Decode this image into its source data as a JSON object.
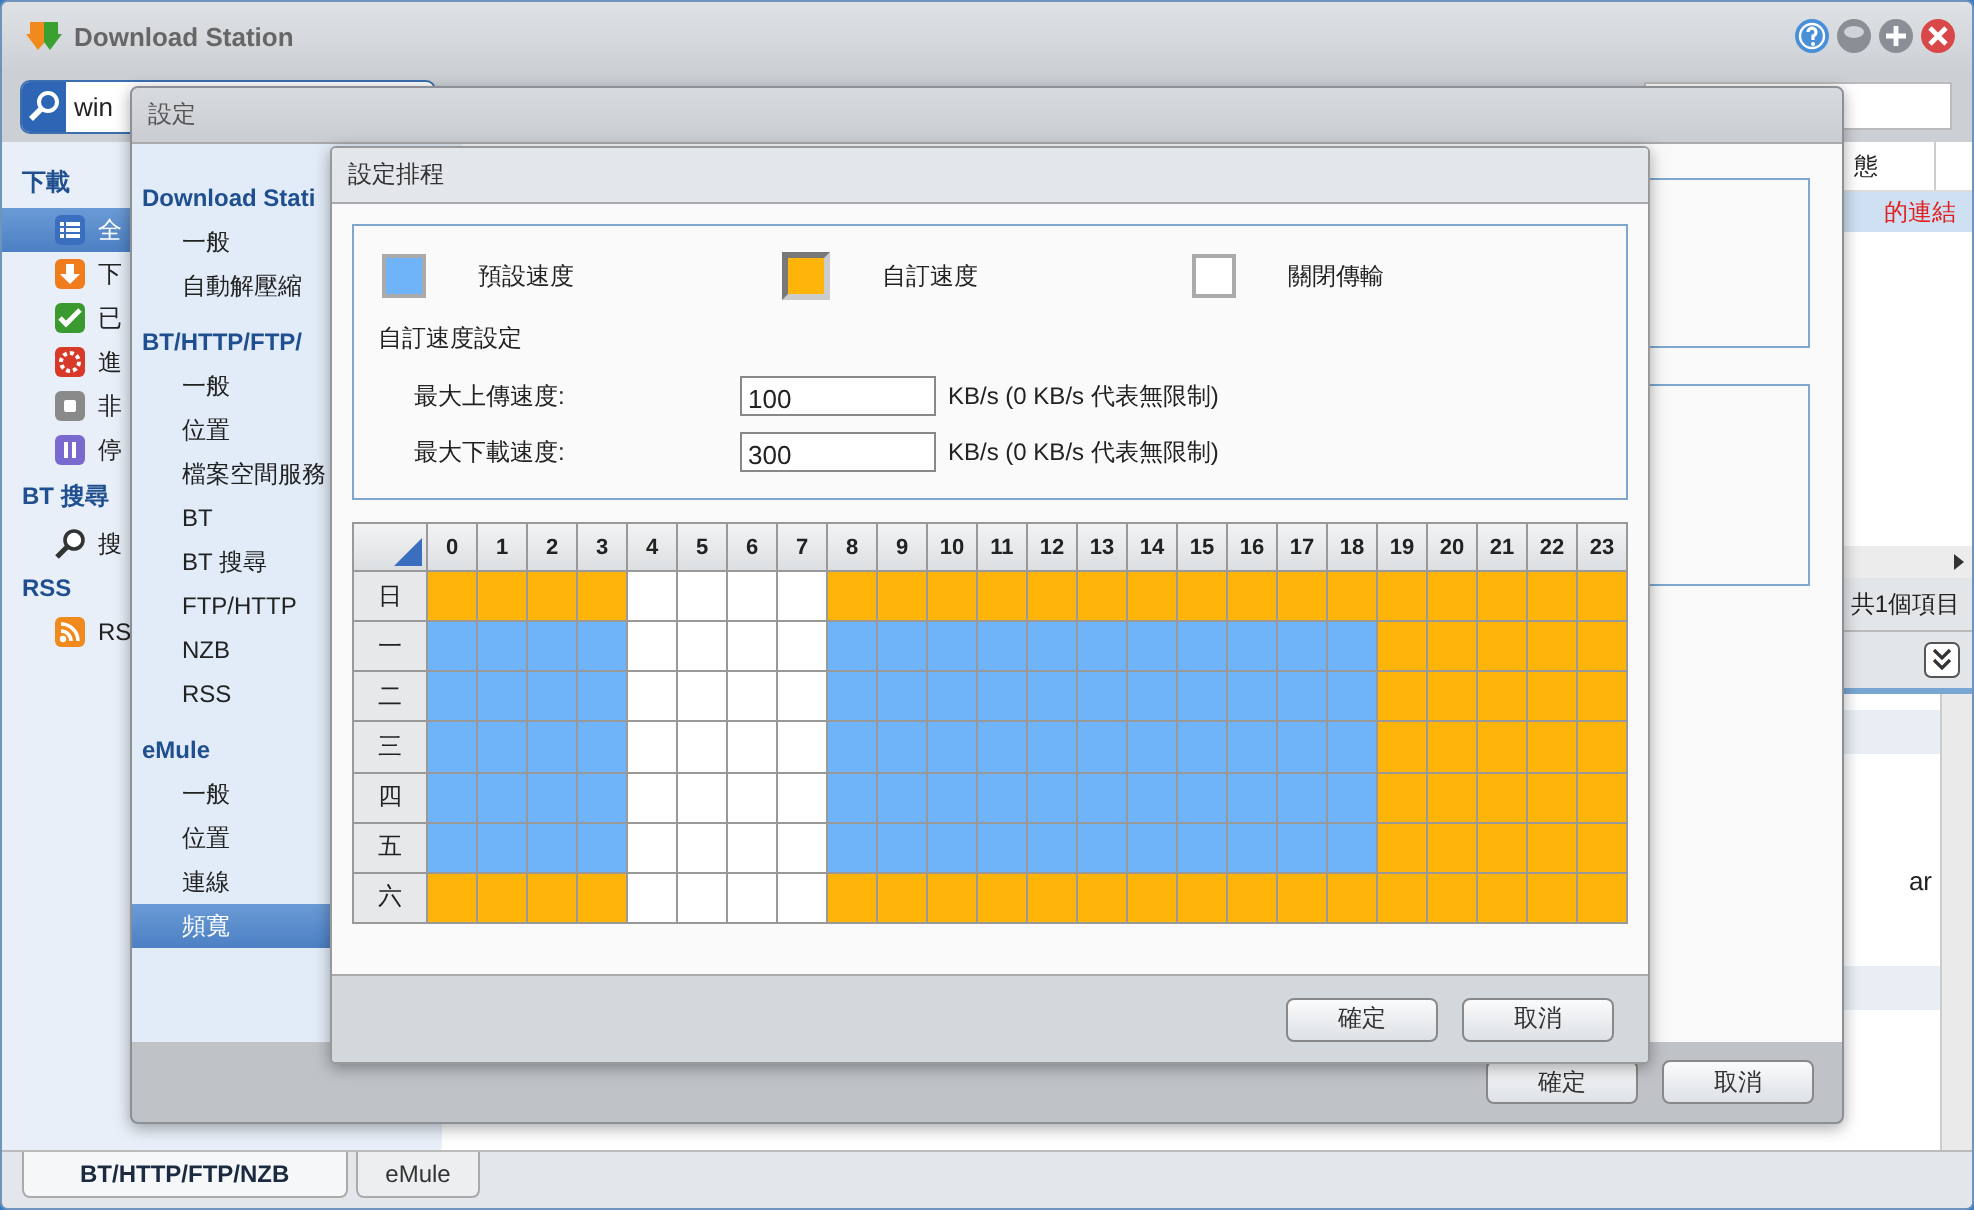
{
  "main_window": {
    "title": "Download Station",
    "search": {
      "value": "win"
    },
    "sidebar": [
      {
        "heading": "下載",
        "items": [
          {
            "label": "全",
            "kind": "list",
            "selected": true
          },
          {
            "label": "下",
            "kind": "download",
            "selected": false
          },
          {
            "label": "已",
            "kind": "done",
            "selected": false
          },
          {
            "label": "進",
            "kind": "active",
            "selected": false
          },
          {
            "label": "非",
            "kind": "inactive",
            "selected": false
          },
          {
            "label": "停",
            "kind": "paused",
            "selected": false
          }
        ]
      },
      {
        "heading": "BT 搜尋",
        "items": [
          {
            "label": "搜",
            "kind": "search",
            "selected": false
          }
        ]
      },
      {
        "heading": "RSS",
        "items": [
          {
            "label": "RS",
            "kind": "rss",
            "selected": false
          }
        ]
      }
    ],
    "list": {
      "column": "態",
      "row": "的連結",
      "status": "共1個項目",
      "detail_text": "ar"
    },
    "bottom_tabs": [
      {
        "label": "BT/HTTP/FTP/NZB",
        "selected": true
      },
      {
        "label": "eMule",
        "selected": false
      }
    ]
  },
  "settings_window": {
    "title": "設定",
    "nav": [
      {
        "heading": "Download Stati",
        "items": [
          {
            "label": "一般",
            "selected": false
          },
          {
            "label": "自動解壓縮",
            "selected": false
          }
        ]
      },
      {
        "heading": "BT/HTTP/FTP/",
        "items": [
          {
            "label": "一般",
            "selected": false
          },
          {
            "label": "位置",
            "selected": false
          },
          {
            "label": "檔案空間服務",
            "selected": false
          },
          {
            "label": "BT",
            "selected": false
          },
          {
            "label": "BT 搜尋",
            "selected": false
          },
          {
            "label": "FTP/HTTP",
            "selected": false
          },
          {
            "label": "NZB",
            "selected": false
          },
          {
            "label": "RSS",
            "selected": false
          }
        ]
      },
      {
        "heading": "eMule",
        "items": [
          {
            "label": "一般",
            "selected": false
          },
          {
            "label": "位置",
            "selected": false
          },
          {
            "label": "連線",
            "selected": false
          },
          {
            "label": "頻寬",
            "selected": true
          }
        ]
      }
    ],
    "buttons": [
      "確定",
      "取消"
    ]
  },
  "schedule_dialog": {
    "title": "設定排程",
    "legend": [
      {
        "label": "預設速度",
        "color": "#6fb4f8",
        "selected": false
      },
      {
        "label": "自訂速度",
        "color": "#ffb40a",
        "selected": true
      },
      {
        "label": "關閉傳輸",
        "color": "#ffffff",
        "selected": false
      }
    ],
    "custom_heading": "自訂速度設定",
    "fields": [
      {
        "label": "最大上傳速度:",
        "value": "100",
        "unit": "KB/s (0 KB/s 代表無限制)"
      },
      {
        "label": "最大下載速度:",
        "value": "300",
        "unit": "KB/s (0 KB/s 代表無限制)"
      }
    ],
    "hours": [
      "0",
      "1",
      "2",
      "3",
      "4",
      "5",
      "6",
      "7",
      "8",
      "9",
      "10",
      "11",
      "12",
      "13",
      "14",
      "15",
      "16",
      "17",
      "18",
      "19",
      "20",
      "21",
      "22",
      "23"
    ],
    "rows": [
      {
        "day": "日",
        "slots": [
          {
            "color": "#ffb40a"
          },
          {
            "color": "#ffb40a"
          },
          {
            "color": "#ffb40a"
          },
          {
            "color": "#ffb40a"
          },
          {
            "color": "#ffffff"
          },
          {
            "color": "#ffffff"
          },
          {
            "color": "#ffffff"
          },
          {
            "color": "#ffffff"
          },
          {
            "color": "#ffb40a"
          },
          {
            "color": "#ffb40a"
          },
          {
            "color": "#ffb40a"
          },
          {
            "color": "#ffb40a"
          },
          {
            "color": "#ffb40a"
          },
          {
            "color": "#ffb40a"
          },
          {
            "color": "#ffb40a"
          },
          {
            "color": "#ffb40a"
          },
          {
            "color": "#ffb40a"
          },
          {
            "color": "#ffb40a"
          },
          {
            "color": "#ffb40a"
          },
          {
            "color": "#ffb40a"
          },
          {
            "color": "#ffb40a"
          },
          {
            "color": "#ffb40a"
          },
          {
            "color": "#ffb40a"
          },
          {
            "color": "#ffb40a"
          }
        ]
      },
      {
        "day": "一",
        "slots": [
          {
            "color": "#6fb4f8"
          },
          {
            "color": "#6fb4f8"
          },
          {
            "color": "#6fb4f8"
          },
          {
            "color": "#6fb4f8"
          },
          {
            "color": "#ffffff"
          },
          {
            "color": "#ffffff"
          },
          {
            "color": "#ffffff"
          },
          {
            "color": "#ffffff"
          },
          {
            "color": "#6fb4f8"
          },
          {
            "color": "#6fb4f8"
          },
          {
            "color": "#6fb4f8"
          },
          {
            "color": "#6fb4f8"
          },
          {
            "color": "#6fb4f8"
          },
          {
            "color": "#6fb4f8"
          },
          {
            "color": "#6fb4f8"
          },
          {
            "color": "#6fb4f8"
          },
          {
            "color": "#6fb4f8"
          },
          {
            "color": "#6fb4f8"
          },
          {
            "color": "#6fb4f8"
          },
          {
            "color": "#ffb40a"
          },
          {
            "color": "#ffb40a"
          },
          {
            "color": "#ffb40a"
          },
          {
            "color": "#ffb40a"
          },
          {
            "color": "#ffb40a"
          }
        ]
      },
      {
        "day": "二",
        "slots": [
          {
            "color": "#6fb4f8"
          },
          {
            "color": "#6fb4f8"
          },
          {
            "color": "#6fb4f8"
          },
          {
            "color": "#6fb4f8"
          },
          {
            "color": "#ffffff"
          },
          {
            "color": "#ffffff"
          },
          {
            "color": "#ffffff"
          },
          {
            "color": "#ffffff"
          },
          {
            "color": "#6fb4f8"
          },
          {
            "color": "#6fb4f8"
          },
          {
            "color": "#6fb4f8"
          },
          {
            "color": "#6fb4f8"
          },
          {
            "color": "#6fb4f8"
          },
          {
            "color": "#6fb4f8"
          },
          {
            "color": "#6fb4f8"
          },
          {
            "color": "#6fb4f8"
          },
          {
            "color": "#6fb4f8"
          },
          {
            "color": "#6fb4f8"
          },
          {
            "color": "#6fb4f8"
          },
          {
            "color": "#ffb40a"
          },
          {
            "color": "#ffb40a"
          },
          {
            "color": "#ffb40a"
          },
          {
            "color": "#ffb40a"
          },
          {
            "color": "#ffb40a"
          }
        ]
      },
      {
        "day": "三",
        "slots": [
          {
            "color": "#6fb4f8"
          },
          {
            "color": "#6fb4f8"
          },
          {
            "color": "#6fb4f8"
          },
          {
            "color": "#6fb4f8"
          },
          {
            "color": "#ffffff"
          },
          {
            "color": "#ffffff"
          },
          {
            "color": "#ffffff"
          },
          {
            "color": "#ffffff"
          },
          {
            "color": "#6fb4f8"
          },
          {
            "color": "#6fb4f8"
          },
          {
            "color": "#6fb4f8"
          },
          {
            "color": "#6fb4f8"
          },
          {
            "color": "#6fb4f8"
          },
          {
            "color": "#6fb4f8"
          },
          {
            "color": "#6fb4f8"
          },
          {
            "color": "#6fb4f8"
          },
          {
            "color": "#6fb4f8"
          },
          {
            "color": "#6fb4f8"
          },
          {
            "color": "#6fb4f8"
          },
          {
            "color": "#ffb40a"
          },
          {
            "color": "#ffb40a"
          },
          {
            "color": "#ffb40a"
          },
          {
            "color": "#ffb40a"
          },
          {
            "color": "#ffb40a"
          }
        ]
      },
      {
        "day": "四",
        "slots": [
          {
            "color": "#6fb4f8"
          },
          {
            "color": "#6fb4f8"
          },
          {
            "color": "#6fb4f8"
          },
          {
            "color": "#6fb4f8"
          },
          {
            "color": "#ffffff"
          },
          {
            "color": "#ffffff"
          },
          {
            "color": "#ffffff"
          },
          {
            "color": "#ffffff"
          },
          {
            "color": "#6fb4f8"
          },
          {
            "color": "#6fb4f8"
          },
          {
            "color": "#6fb4f8"
          },
          {
            "color": "#6fb4f8"
          },
          {
            "color": "#6fb4f8"
          },
          {
            "color": "#6fb4f8"
          },
          {
            "color": "#6fb4f8"
          },
          {
            "color": "#6fb4f8"
          },
          {
            "color": "#6fb4f8"
          },
          {
            "color": "#6fb4f8"
          },
          {
            "color": "#6fb4f8"
          },
          {
            "color": "#ffb40a"
          },
          {
            "color": "#ffb40a"
          },
          {
            "color": "#ffb40a"
          },
          {
            "color": "#ffb40a"
          },
          {
            "color": "#ffb40a"
          }
        ]
      },
      {
        "day": "五",
        "slots": [
          {
            "color": "#6fb4f8"
          },
          {
            "color": "#6fb4f8"
          },
          {
            "color": "#6fb4f8"
          },
          {
            "color": "#6fb4f8"
          },
          {
            "color": "#ffffff"
          },
          {
            "color": "#ffffff"
          },
          {
            "color": "#ffffff"
          },
          {
            "color": "#ffffff"
          },
          {
            "color": "#6fb4f8"
          },
          {
            "color": "#6fb4f8"
          },
          {
            "color": "#6fb4f8"
          },
          {
            "color": "#6fb4f8"
          },
          {
            "color": "#6fb4f8"
          },
          {
            "color": "#6fb4f8"
          },
          {
            "color": "#6fb4f8"
          },
          {
            "color": "#6fb4f8"
          },
          {
            "color": "#6fb4f8"
          },
          {
            "color": "#6fb4f8"
          },
          {
            "color": "#6fb4f8"
          },
          {
            "color": "#ffb40a"
          },
          {
            "color": "#ffb40a"
          },
          {
            "color": "#ffb40a"
          },
          {
            "color": "#ffb40a"
          },
          {
            "color": "#ffb40a"
          }
        ]
      },
      {
        "day": "六",
        "slots": [
          {
            "color": "#ffb40a"
          },
          {
            "color": "#ffb40a"
          },
          {
            "color": "#ffb40a"
          },
          {
            "color": "#ffb40a"
          },
          {
            "color": "#ffffff"
          },
          {
            "color": "#ffffff"
          },
          {
            "color": "#ffffff"
          },
          {
            "color": "#ffffff"
          },
          {
            "color": "#ffb40a"
          },
          {
            "color": "#ffb40a"
          },
          {
            "color": "#ffb40a"
          },
          {
            "color": "#ffb40a"
          },
          {
            "color": "#ffb40a"
          },
          {
            "color": "#ffb40a"
          },
          {
            "color": "#ffb40a"
          },
          {
            "color": "#ffb40a"
          },
          {
            "color": "#ffb40a"
          },
          {
            "color": "#ffb40a"
          },
          {
            "color": "#ffb40a"
          },
          {
            "color": "#ffb40a"
          },
          {
            "color": "#ffb40a"
          },
          {
            "color": "#ffb40a"
          },
          {
            "color": "#ffb40a"
          },
          {
            "color": "#ffb40a"
          }
        ]
      }
    ],
    "buttons": [
      "確定",
      "取消"
    ]
  }
}
